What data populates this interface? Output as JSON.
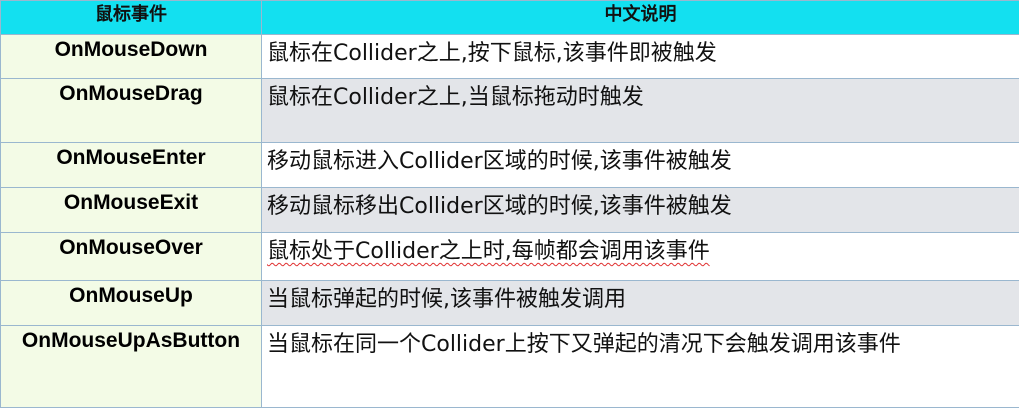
{
  "header": {
    "col_event": "鼠标事件",
    "col_desc": "中文说明"
  },
  "rows": [
    {
      "event": "OnMouseDown",
      "desc": "鼠标在Collider之上,按下鼠标,该事件即被触发"
    },
    {
      "event": "OnMouseDrag",
      "desc": "鼠标在Collider之上,当鼠标拖动时触发"
    },
    {
      "event": "OnMouseEnter",
      "desc": "移动鼠标进入Collider区域的时候,该事件被触发"
    },
    {
      "event": "OnMouseExit",
      "desc": "移动鼠标移出Collider区域的时候,该事件被触发"
    },
    {
      "event": "OnMouseOver",
      "desc": "鼠标处于Collider之上时,每帧都会调用该事件"
    },
    {
      "event": "OnMouseUp",
      "desc": "当鼠标弹起的时候,该事件被触发调用"
    },
    {
      "event": "OnMouseUpAsButton",
      "desc": "当鼠标在同一个Collider上按下又弹起的清况下会触发调用该事件"
    }
  ],
  "colors": {
    "header_bg": "#13e0f0",
    "event_col_bg": "#f3fbe6",
    "alt_row_bg": "#e3e5e9",
    "border": "#9ab7cf"
  }
}
